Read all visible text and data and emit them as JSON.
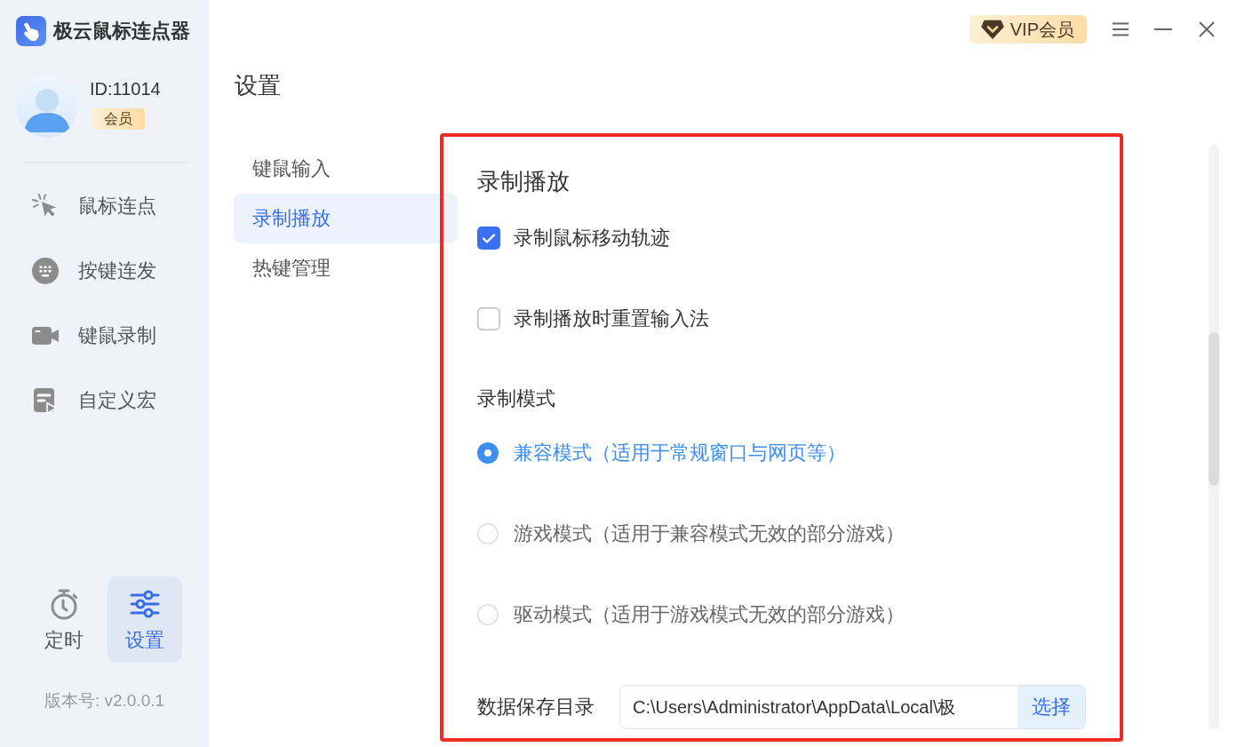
{
  "app": {
    "title": "极云鼠标连点器"
  },
  "user": {
    "id": "ID:11014",
    "badge": "会员"
  },
  "sidebar": {
    "items": [
      {
        "label": "鼠标连点",
        "selected": false
      },
      {
        "label": "按键连发",
        "selected": false
      },
      {
        "label": "键鼠录制",
        "selected": false
      },
      {
        "label": "自定义宏",
        "selected": false
      }
    ],
    "bottom_tabs": [
      {
        "label": "定时",
        "selected": false
      },
      {
        "label": "设置",
        "selected": true
      }
    ],
    "version": "版本号: v2.0.0.1"
  },
  "header": {
    "vip_button": "VIP会员"
  },
  "page_title": "设置",
  "subnav": [
    {
      "label": "键鼠输入",
      "selected": false
    },
    {
      "label": "录制播放",
      "selected": true
    },
    {
      "label": "热键管理",
      "selected": false
    }
  ],
  "section": {
    "title": "录制播放",
    "options": [
      {
        "label": "录制鼠标移动轨迹",
        "checked": true
      },
      {
        "label": "录制播放时重置输入法",
        "checked": false
      }
    ],
    "mode_title": "录制模式",
    "modes": [
      {
        "label": "兼容模式（适用于常规窗口与网页等）",
        "selected": true
      },
      {
        "label": "游戏模式（适用于兼容模式无效的部分游戏）",
        "selected": false
      },
      {
        "label": "驱动模式（适用于游戏模式无效的部分游戏）",
        "selected": false
      }
    ],
    "save_dir": {
      "label": "数据保存目录",
      "value": "C:\\Users\\Administrator\\AppData\\Local\\极",
      "button": "选择"
    }
  }
}
